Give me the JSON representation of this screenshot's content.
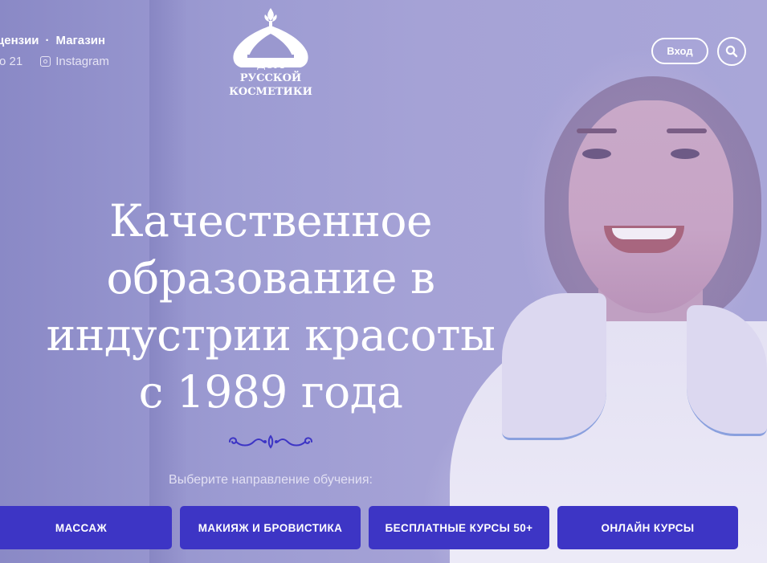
{
  "header": {
    "nav_links": [
      "цензии",
      "Магазин"
    ],
    "nav_separator": "·",
    "schedule_text": "о 21",
    "instagram_label": "Instagram",
    "logo_lines": [
      "ДОМ",
      "РУССКОЙ",
      "КОСМЕТИКИ"
    ],
    "login_label": "Вход",
    "search_icon": "search-icon"
  },
  "hero": {
    "title_lines": [
      "Качественное",
      "образование в",
      "индустрии красоты",
      "с 1989 года"
    ],
    "prompt": "Выберите направление обучения:",
    "buttons": [
      "МАССАЖ",
      "МАКИЯЖ И БРОВИСТИКА",
      "БЕСПЛАТНЫЕ КУРСЫ 50+",
      "ОНЛАЙН КУРСЫ"
    ]
  },
  "colors": {
    "overlay": "#9a98cf",
    "button_bg": "#3d35c5",
    "text": "#ffffff"
  }
}
